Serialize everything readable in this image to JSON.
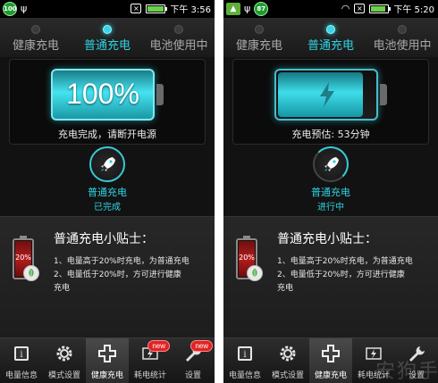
{
  "screens": [
    {
      "status_bar": {
        "badge": "100",
        "time": "下午 3:56"
      },
      "modes": [
        {
          "label": "健康充电",
          "active": false
        },
        {
          "label": "普通充电",
          "active": true
        },
        {
          "label": "电池使用中",
          "active": false
        }
      ],
      "battery": {
        "level_percent": 100,
        "text": "100%",
        "status": "充电完成，请断开电源"
      },
      "current_mode": {
        "name": "普通充电",
        "state": "已完成"
      },
      "tips": {
        "title": "普通充电小贴士：",
        "battery_label": "20%",
        "lines": [
          "1、电量高于20%时充电，为普通充电",
          "2、电量低于20%时，方可进行健康",
          "充电"
        ]
      },
      "nav": [
        {
          "label": "电量信息",
          "icon": "info-icon",
          "badge": ""
        },
        {
          "label": "模式设置",
          "icon": "gear-icon",
          "badge": ""
        },
        {
          "label": "健康充电",
          "icon": "plus-icon",
          "badge": "",
          "active": true
        },
        {
          "label": "耗电统计",
          "icon": "stats-icon",
          "badge": "new"
        },
        {
          "label": "设置",
          "icon": "wrench-icon",
          "badge": "new"
        }
      ]
    },
    {
      "status_bar": {
        "badge": "87",
        "time": "下午 5:20"
      },
      "modes": [
        {
          "label": "健康充电",
          "active": false
        },
        {
          "label": "普通充电",
          "active": true
        },
        {
          "label": "电池使用中",
          "active": false
        }
      ],
      "battery": {
        "level_percent": 88,
        "status": "充电预估: 53分钟"
      },
      "current_mode": {
        "name": "普通充电",
        "state": "进行中"
      },
      "tips": {
        "title": "普通充电小贴士：",
        "battery_label": "20%",
        "lines": [
          "1、电量高于20%时充电，为普通充电",
          "2、电量低于20%时，方可进行健康",
          "充电"
        ]
      },
      "nav": [
        {
          "label": "电量信息",
          "icon": "info-icon",
          "badge": ""
        },
        {
          "label": "模式设置",
          "icon": "gear-icon",
          "badge": ""
        },
        {
          "label": "健康充电",
          "icon": "plus-icon",
          "badge": "",
          "active": true
        },
        {
          "label": "耗电统计",
          "icon": "stats-icon",
          "badge": ""
        },
        {
          "label": "设置",
          "icon": "wrench-icon",
          "badge": ""
        }
      ]
    }
  ],
  "watermark": "安狗手机",
  "colors": {
    "accent": "#2fd3e4",
    "battery": "#45e3f0",
    "low_battery": "#b41c1c",
    "badge": "#e12323"
  }
}
